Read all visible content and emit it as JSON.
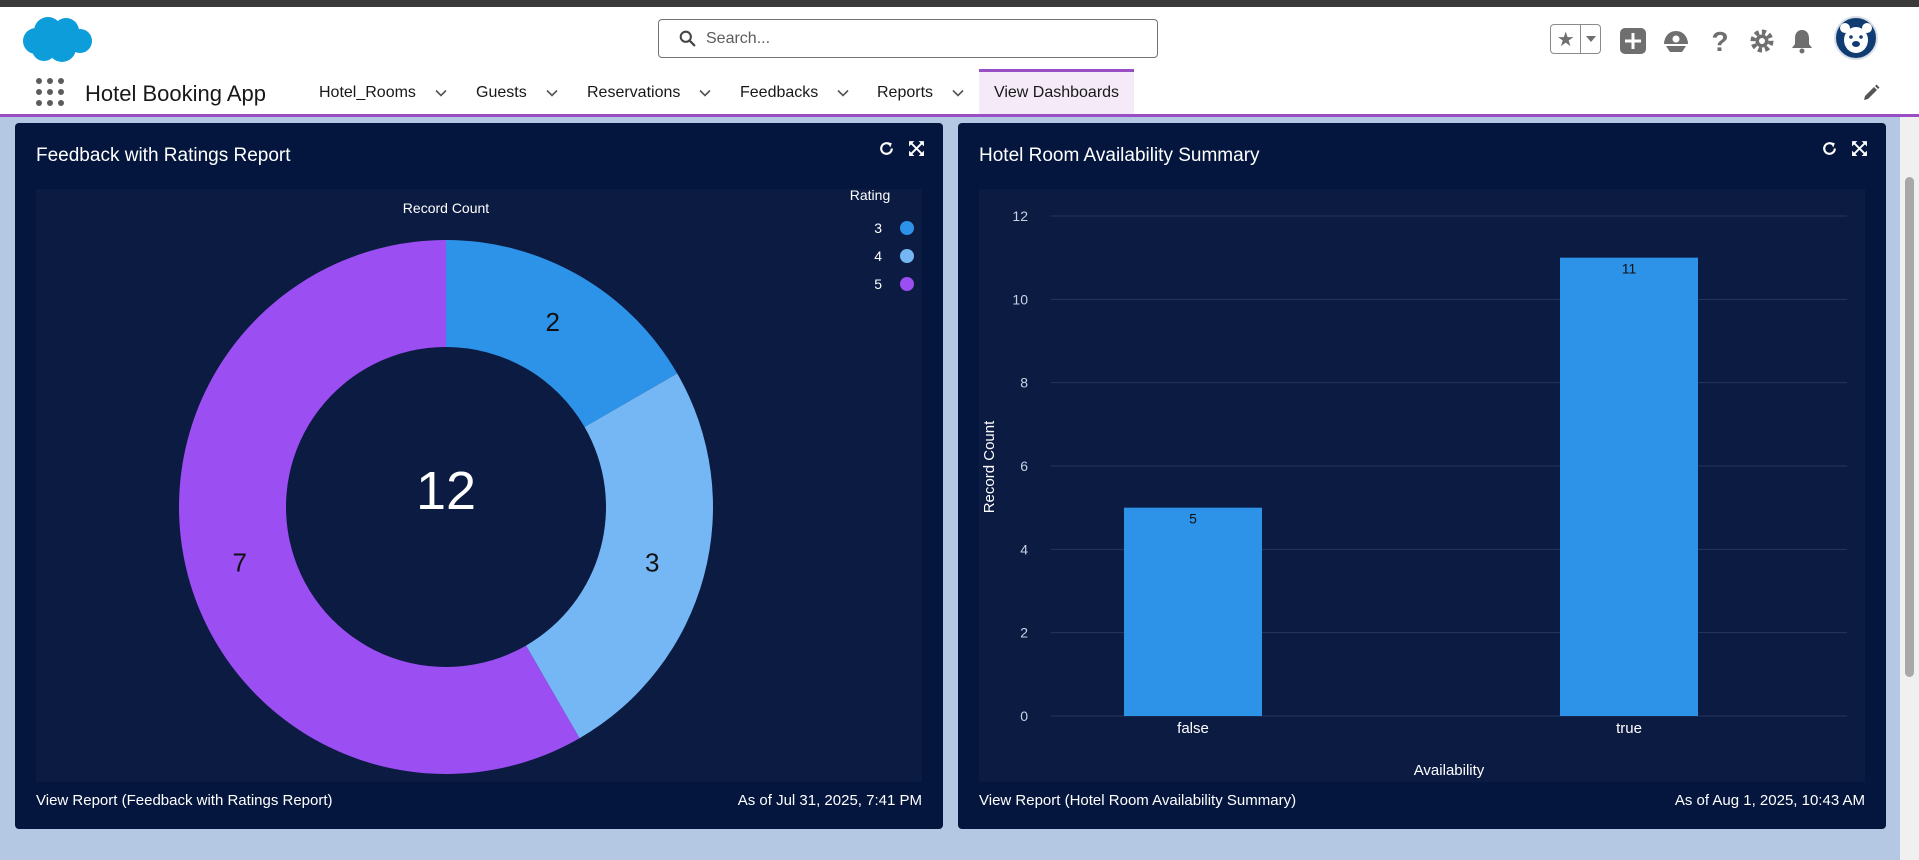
{
  "header": {
    "search_placeholder": "Search...",
    "icons": [
      "salesforce-cloud-logo",
      "favorites-star-icon",
      "chevron-down-icon",
      "add-icon",
      "trailhead-icon",
      "help-icon",
      "setup-gear-icon",
      "notifications-bell-icon",
      "avatar"
    ]
  },
  "app": {
    "name": "Hotel Booking App",
    "nav_items": [
      {
        "label": "Hotel_Rooms"
      },
      {
        "label": "Guests"
      },
      {
        "label": "Reservations"
      },
      {
        "label": "Feedbacks"
      },
      {
        "label": "Reports"
      }
    ],
    "active_tab": "View Dashboards"
  },
  "colors": {
    "panel_bg": "#04163d",
    "chart_bg": "#0b1b42",
    "rating_3": "#2d93e8",
    "rating_4": "#75b7f4",
    "rating_5": "#9b4ef2",
    "bar": "#2d93e8",
    "accent": "#9a4ec5"
  },
  "panels": [
    {
      "title": "Feedback with Ratings Report",
      "footer_link": "View Report (Feedback with Ratings Report)",
      "timestamp": "As of Jul 31, 2025, 7:41 PM"
    },
    {
      "title": "Hotel Room Availability Summary",
      "footer_link": "View Report (Hotel Room Availability Summary)",
      "timestamp": "As of Aug 1, 2025, 10:43 AM"
    }
  ],
  "chart_data": [
    {
      "type": "pie",
      "title": "Record Count",
      "legend_title": "Rating",
      "legend_position": "top-right",
      "center_total": "12",
      "slices": [
        {
          "label": "3",
          "value": 2
        },
        {
          "label": "4",
          "value": 3
        },
        {
          "label": "5",
          "value": 7
        }
      ]
    },
    {
      "type": "bar",
      "categories": [
        "false",
        "true"
      ],
      "values": [
        5,
        11
      ],
      "xlabel": "Availability",
      "ylabel": "Record Count",
      "ylim": [
        0,
        12
      ],
      "yticks": [
        "0",
        "2",
        "4",
        "6",
        "8",
        "10",
        "12"
      ],
      "grid": true
    }
  ]
}
